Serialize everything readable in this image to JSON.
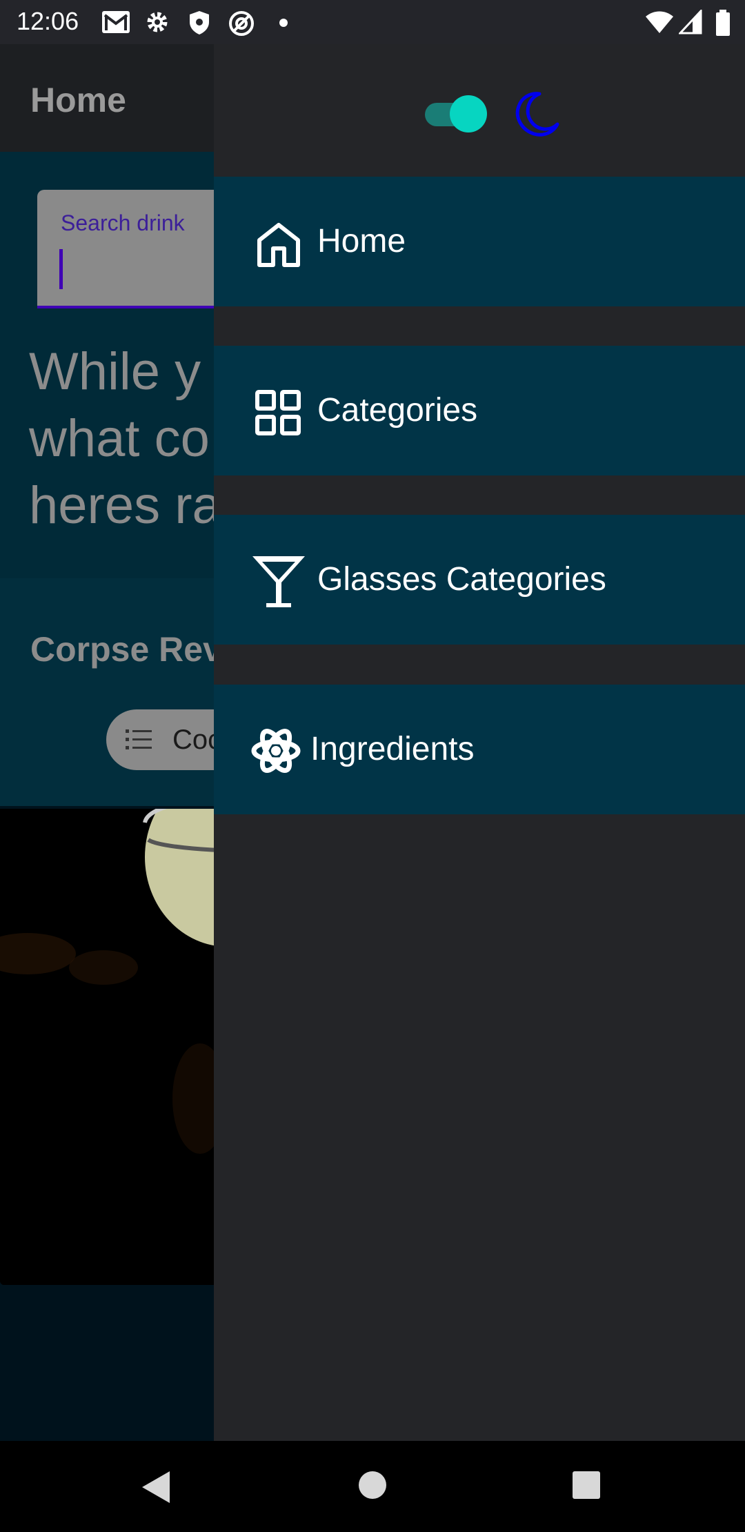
{
  "status_bar": {
    "time": "12:06",
    "left_icons": [
      "gmail-icon",
      "settings-icon",
      "shield-icon",
      "vpn-icon",
      "dot-icon"
    ],
    "right_icons": [
      "wifi-icon",
      "cellular-icon",
      "battery-icon"
    ]
  },
  "background_app": {
    "title": "Home",
    "search": {
      "label": "Search drink"
    },
    "headline_lines": [
      "While y",
      "what co",
      "heres ra"
    ],
    "card": {
      "title": "Corpse Rev",
      "chip_label": "Coc"
    }
  },
  "drawer": {
    "theme_toggle_on": true,
    "items": [
      {
        "label": "Home",
        "icon": "home-icon"
      },
      {
        "label": "Categories",
        "icon": "grid-icon"
      },
      {
        "label": "Glasses Categories",
        "icon": "cocktail-glass-icon"
      },
      {
        "label": "Ingredients",
        "icon": "atom-icon"
      }
    ]
  },
  "colors": {
    "drawer_bg": "#242528",
    "nav_item_bg": "#013447",
    "toggle_thumb": "#07d5c1",
    "moon": "#0000ee",
    "status_bar": "#24252a"
  }
}
